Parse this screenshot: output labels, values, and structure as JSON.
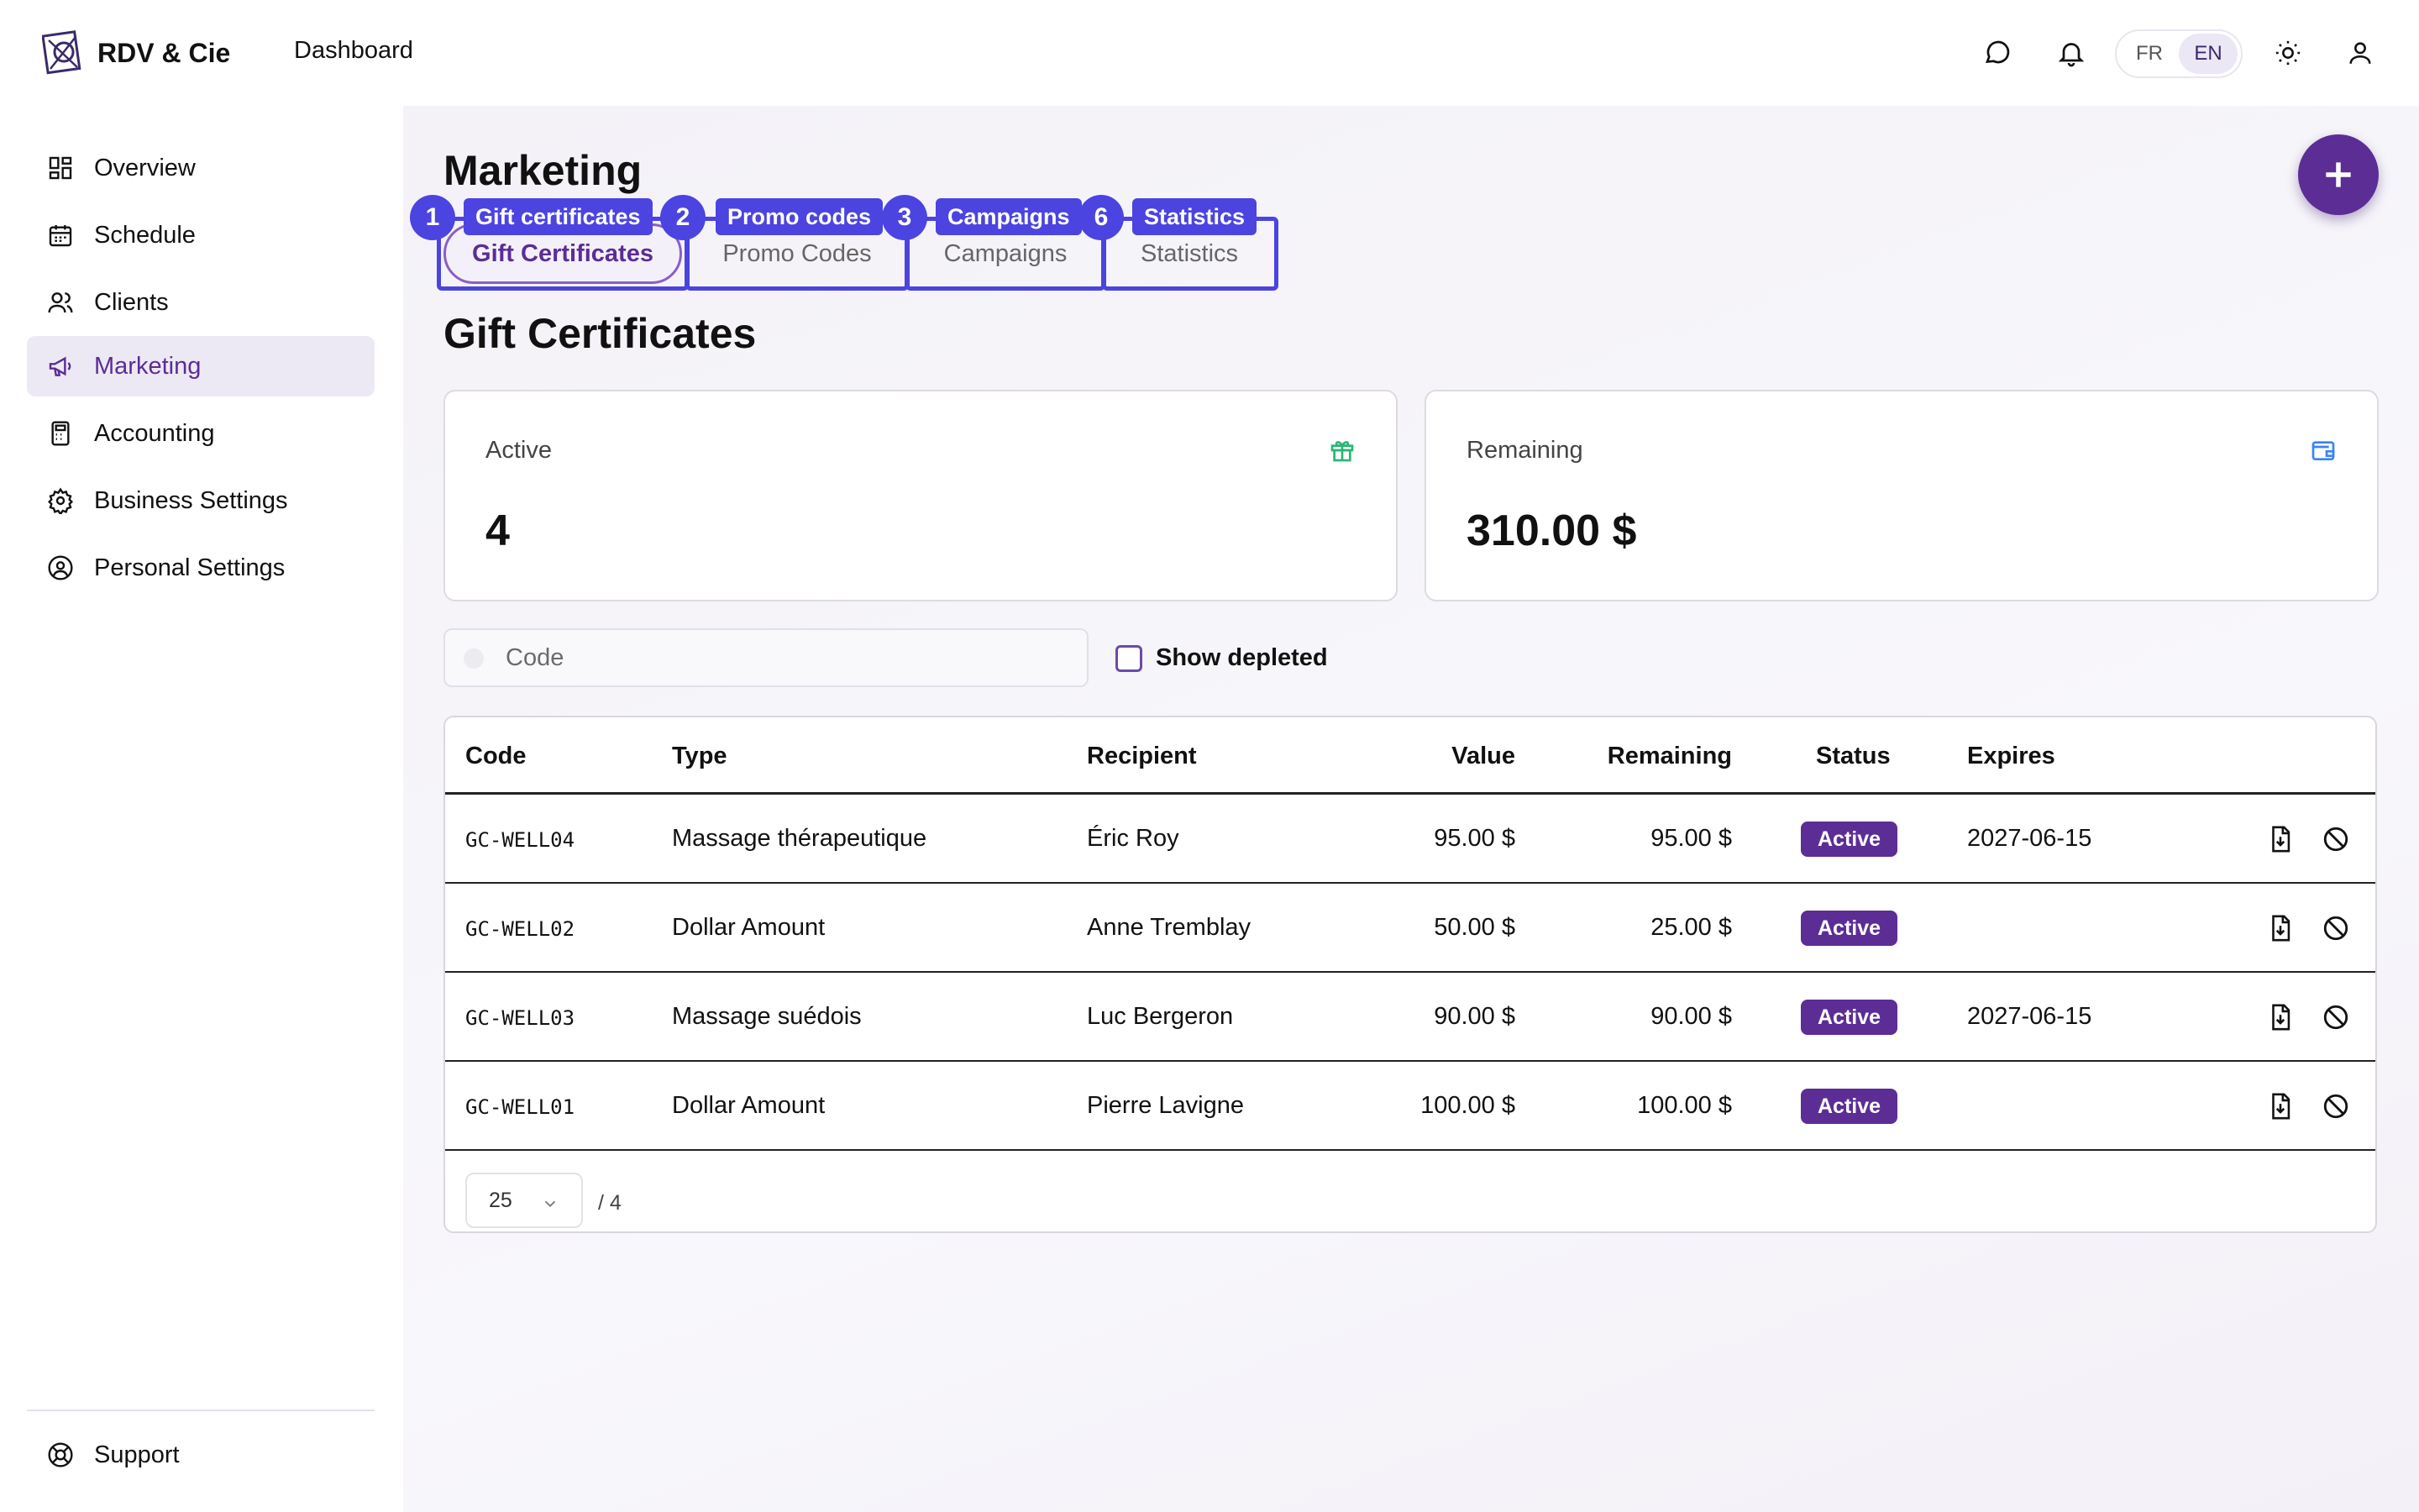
{
  "app": {
    "brand": "RDV & Cie",
    "header_link": "Dashboard",
    "languages": [
      "FR",
      "EN"
    ],
    "selected_language": "EN"
  },
  "sidebar": {
    "items": [
      {
        "label": "Overview",
        "icon": "grid-icon"
      },
      {
        "label": "Schedule",
        "icon": "calendar-icon"
      },
      {
        "label": "Clients",
        "icon": "users-icon"
      },
      {
        "label": "Marketing",
        "icon": "megaphone-icon",
        "active": true
      },
      {
        "label": "Accounting",
        "icon": "calculator-icon"
      },
      {
        "label": "Business Settings",
        "icon": "gear-icon"
      },
      {
        "label": "Personal Settings",
        "icon": "user-circle-icon"
      }
    ],
    "support_label": "Support"
  },
  "page": {
    "title": "Marketing",
    "section_title": "Gift Certificates"
  },
  "tabs": [
    {
      "label": "Gift Certificates",
      "tag": "Gift certificates",
      "number": "1",
      "selected": true
    },
    {
      "label": "Promo Codes",
      "tag": "Promo codes",
      "number": "2"
    },
    {
      "label": "Campaigns",
      "tag": "Campaigns",
      "number": "3"
    },
    {
      "label": "Statistics",
      "tag": "Statistics",
      "number": "6"
    }
  ],
  "cards": {
    "active_label": "Active",
    "active_value": "4",
    "remaining_label": "Remaining",
    "remaining_value": "310.00 $"
  },
  "filters": {
    "search_placeholder": "Code",
    "show_depleted_label": "Show depleted"
  },
  "table": {
    "columns": [
      "Code",
      "Type",
      "Recipient",
      "Value",
      "Remaining",
      "Status",
      "Expires"
    ],
    "rows": [
      {
        "code": "GC-WELL04",
        "type": "Massage thérapeutique",
        "recipient": "Éric Roy",
        "value": "95.00 $",
        "remaining": "95.00 $",
        "status": "Active",
        "expires": "2027-06-15"
      },
      {
        "code": "GC-WELL02",
        "type": "Dollar Amount",
        "recipient": "Anne Tremblay",
        "value": "50.00 $",
        "remaining": "25.00 $",
        "status": "Active",
        "expires": ""
      },
      {
        "code": "GC-WELL03",
        "type": "Massage suédois",
        "recipient": "Luc Bergeron",
        "value": "90.00 $",
        "remaining": "90.00 $",
        "status": "Active",
        "expires": "2027-06-15"
      },
      {
        "code": "GC-WELL01",
        "type": "Dollar Amount",
        "recipient": "Pierre Lavigne",
        "value": "100.00 $",
        "remaining": "100.00 $",
        "status": "Active",
        "expires": ""
      }
    ],
    "page_size": "25",
    "total": "/ 4"
  },
  "colors": {
    "accent": "#5b2d95",
    "highlight": "#4b44e0",
    "gift_icon": "#2bb673",
    "wallet_icon": "#3b82f6"
  }
}
